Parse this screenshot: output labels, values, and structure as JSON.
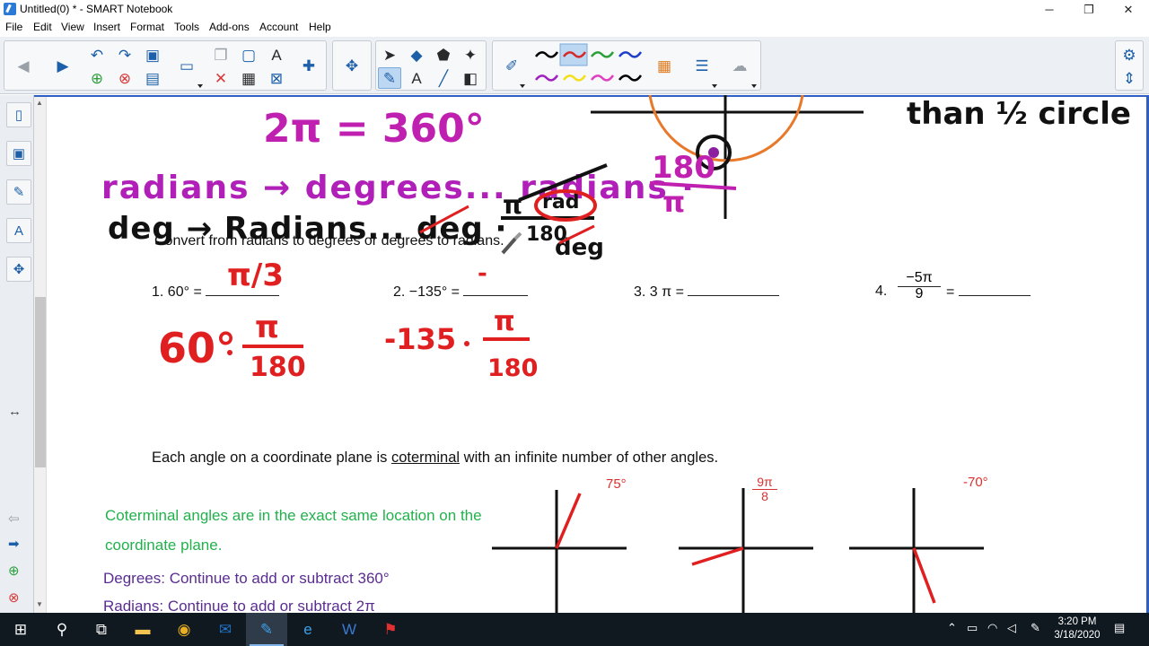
{
  "window": {
    "title": "Untitled(0) * - SMART Notebook",
    "minimize": "─",
    "restore": "❐",
    "close": "✕"
  },
  "menu": [
    "File",
    "Edit",
    "View",
    "Insert",
    "Format",
    "Tools",
    "Add-ons",
    "Account",
    "Help"
  ],
  "toolbar": {
    "pen_colors": [
      "#000000",
      "#d42a2a",
      "#2aa13a",
      "#1f3fc8",
      "#a020c0",
      "#f2e01a",
      "#e040c0",
      "#000000"
    ]
  },
  "worksheet": {
    "heading": "Convert from radians to degrees or degrees to radians.",
    "problems": [
      {
        "number": "1.",
        "expr": "60° ="
      },
      {
        "number": "2.",
        "expr": "−135° ="
      },
      {
        "number": "3.",
        "expr": "3 π ="
      },
      {
        "number": "4.",
        "expr_num": "−5π",
        "expr_den": "9",
        "expr_eq": "="
      }
    ],
    "coterminal_before": "Each angle on a coordinate plane is ",
    "coterminal_word": "coterminal",
    "coterminal_after": " with an infinite number of other angles.",
    "coterminal_definition": "Coterminal angles are in the exact same location on the coordinate plane.",
    "degrees_rule": "Degrees: Continue to add or subtract 360°",
    "radians_rule": "Radians: Continue to add or subtract 2π",
    "angle_labels": {
      "first": "75°",
      "second_num": "9π",
      "second_den": "8",
      "third": "-70°"
    }
  },
  "handwriting": {
    "line1": "2π = 360°",
    "line2": "radians → degrees... radians ·",
    "line3": "deg → Radians... deg ·",
    "note": "than ½ circle",
    "frac_180_over_pi_num": "180",
    "frac_180_over_pi_den": "π",
    "frac_pi_over_180_num": "π",
    "frac_pi_over_180_den": "180",
    "rad_word": "rad",
    "deg_word": "deg",
    "answer1": "π/3",
    "work1_value": "60°",
    "work2_value": "-135",
    "dash": "-"
  },
  "taskbar": {
    "time": "3:20 PM",
    "date": "3/18/2020"
  }
}
